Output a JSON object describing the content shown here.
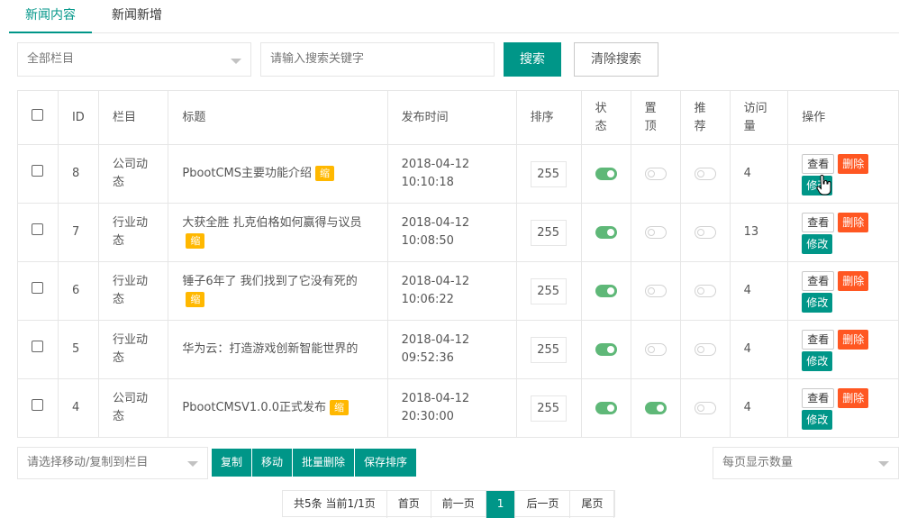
{
  "tabs": [
    {
      "label": "新闻内容",
      "active": true
    },
    {
      "label": "新闻新增",
      "active": false
    }
  ],
  "search": {
    "column_select": "全部栏目",
    "keyword_placeholder": "请输入搜索关键字",
    "search_button": "搜索",
    "clear_button": "清除搜索"
  },
  "table": {
    "headers": {
      "id": "ID",
      "column": "栏目",
      "title": "标题",
      "pubtime": "发布时间",
      "sort": "排序",
      "status": "状态",
      "top": "置顶",
      "recommend": "推荐",
      "visits": "访问量",
      "ops": "操作"
    },
    "rows": [
      {
        "id": "8",
        "column": "公司动态",
        "title": "PbootCMS主要功能介绍",
        "badge": "缩",
        "date": "2018-04-12",
        "time": "10:10:18",
        "sort": "255",
        "status": true,
        "top": false,
        "recommend": false,
        "visits": "4"
      },
      {
        "id": "7",
        "column": "行业动态",
        "title": "大获全胜 扎克伯格如何赢得与议员",
        "badge": "缩",
        "date": "2018-04-12",
        "time": "10:08:50",
        "sort": "255",
        "status": true,
        "top": false,
        "recommend": false,
        "visits": "13"
      },
      {
        "id": "6",
        "column": "行业动态",
        "title": "锤子6年了 我们找到了它没有死的",
        "badge": "缩",
        "date": "2018-04-12",
        "time": "10:06:22",
        "sort": "255",
        "status": true,
        "top": false,
        "recommend": false,
        "visits": "4"
      },
      {
        "id": "5",
        "column": "行业动态",
        "title": "华为云：打造游戏创新智能世界的",
        "badge": "",
        "date": "2018-04-12",
        "time": "09:52:36",
        "sort": "255",
        "status": true,
        "top": false,
        "recommend": false,
        "visits": "4"
      },
      {
        "id": "4",
        "column": "公司动态",
        "title": "PbootCMSV1.0.0正式发布",
        "badge": "缩",
        "date": "2018-04-12",
        "time": "20:30:00",
        "sort": "255",
        "status": true,
        "top": true,
        "recommend": false,
        "visits": "4"
      }
    ],
    "op_labels": {
      "view": "查看",
      "delete": "删除",
      "edit": "修改"
    }
  },
  "batch": {
    "move_select": "请选择移动/复制到栏目",
    "buttons": [
      "复制",
      "移动",
      "批量删除",
      "保存排序"
    ],
    "page_size_select": "每页显示数量"
  },
  "pager": {
    "items": [
      "共5条 当前1/1页",
      "首页",
      "前一页",
      "1",
      "后一页",
      "尾页"
    ],
    "current": "1"
  },
  "colors": {
    "accent": "#009688",
    "danger": "#ff5722",
    "warn": "#ffb800",
    "switch_on": "#5fb878"
  }
}
